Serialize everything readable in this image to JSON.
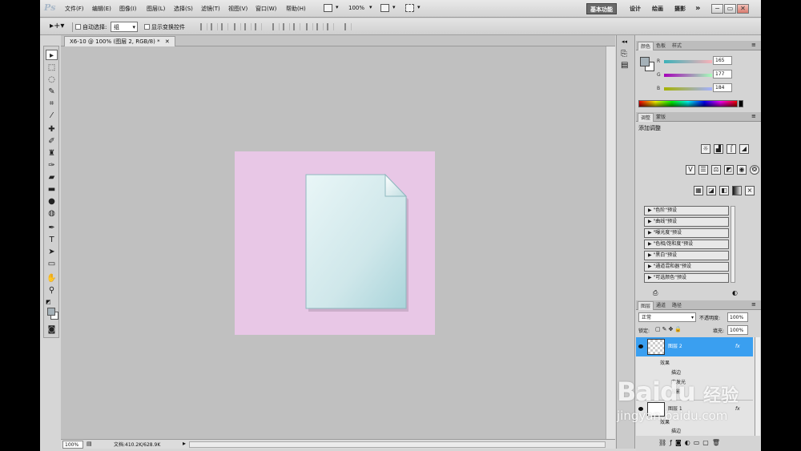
{
  "app": {
    "logo": "Ps"
  },
  "menu": [
    "文件(F)",
    "编辑(E)",
    "图像(I)",
    "图层(L)",
    "选择(S)",
    "滤镜(T)",
    "视图(V)",
    "窗口(W)",
    "帮助(H)"
  ],
  "zoom_select": "100%",
  "workspace": {
    "active": "基本功能",
    "items": [
      "设计",
      "绘画",
      "摄影"
    ],
    "more": "»"
  },
  "window_controls": [
    "−",
    "▭",
    "✕"
  ],
  "options": {
    "auto_select_label": "自动选择:",
    "auto_select_value": "组",
    "show_transform_label": "显示变换控件"
  },
  "document": {
    "tab_title": "X6-10 @ 100% (图层 2, RGB/8) *",
    "tab_close": "✕",
    "status_zoom": "100%",
    "status_doc": "文档:410.2K/628.9K"
  },
  "color_panel": {
    "tabs": [
      "颜色",
      "色板",
      "样式"
    ],
    "channels": [
      {
        "label": "R",
        "value": "165"
      },
      {
        "label": "G",
        "value": "177"
      },
      {
        "label": "B",
        "value": "184"
      }
    ],
    "fg_color": "#a5b1b8",
    "bg_color": "#ffffff"
  },
  "adjust_panel": {
    "tabs": [
      "调整",
      "蒙版"
    ],
    "title": "添加调整",
    "presets": [
      "\"色阶\"预设",
      "\"曲线\"预设",
      "\"曝光度\"预设",
      "\"色相/饱和度\"预设",
      "\"黑白\"预设",
      "\"通道混和器\"预设",
      "\"可选颜色\"预设"
    ]
  },
  "layers_panel": {
    "tabs": [
      "图层",
      "通道",
      "路径"
    ],
    "blend_mode": "正常",
    "opacity_label": "不透明度:",
    "opacity_value": "100%",
    "lock_label": "锁定:",
    "fill_label": "填充:",
    "fill_value": "100%",
    "layers": [
      {
        "name": "图层 2",
        "selected": true,
        "fx": "fx"
      },
      {
        "name": "效果",
        "sub": true
      },
      {
        "name": "描边",
        "sub": true
      },
      {
        "name": "内发光",
        "sub": true
      },
      {
        "name": "投影",
        "sub": true
      },
      {
        "name": "图层 1",
        "fx": "fx"
      },
      {
        "name": "效果",
        "sub": true
      },
      {
        "name": "描边",
        "sub": true
      }
    ]
  },
  "watermark": {
    "brand": "Bai",
    "brand2": "du",
    "jingyan": "经验",
    "url": "jingyan.baidu.com"
  },
  "colors": {
    "canvas_bg": "#c0c0c0",
    "pink": "#e8c7e6",
    "selection_blue": "#3a9ff0"
  }
}
